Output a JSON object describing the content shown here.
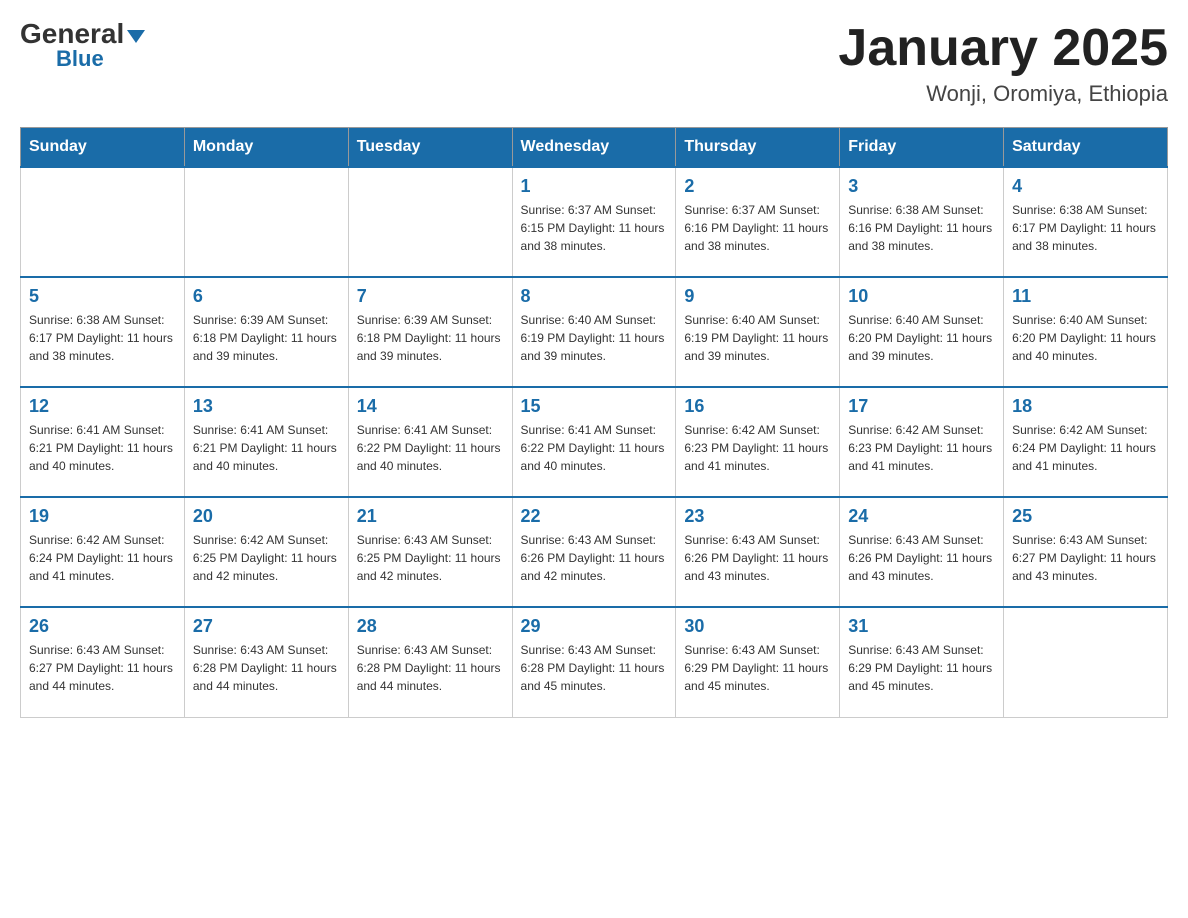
{
  "header": {
    "logo_general": "General",
    "logo_blue": "Blue",
    "month_title": "January 2025",
    "location": "Wonji, Oromiya, Ethiopia"
  },
  "days_of_week": [
    "Sunday",
    "Monday",
    "Tuesday",
    "Wednesday",
    "Thursday",
    "Friday",
    "Saturday"
  ],
  "weeks": [
    [
      {
        "day": "",
        "info": ""
      },
      {
        "day": "",
        "info": ""
      },
      {
        "day": "",
        "info": ""
      },
      {
        "day": "1",
        "info": "Sunrise: 6:37 AM\nSunset: 6:15 PM\nDaylight: 11 hours\nand 38 minutes."
      },
      {
        "day": "2",
        "info": "Sunrise: 6:37 AM\nSunset: 6:16 PM\nDaylight: 11 hours\nand 38 minutes."
      },
      {
        "day": "3",
        "info": "Sunrise: 6:38 AM\nSunset: 6:16 PM\nDaylight: 11 hours\nand 38 minutes."
      },
      {
        "day": "4",
        "info": "Sunrise: 6:38 AM\nSunset: 6:17 PM\nDaylight: 11 hours\nand 38 minutes."
      }
    ],
    [
      {
        "day": "5",
        "info": "Sunrise: 6:38 AM\nSunset: 6:17 PM\nDaylight: 11 hours\nand 38 minutes."
      },
      {
        "day": "6",
        "info": "Sunrise: 6:39 AM\nSunset: 6:18 PM\nDaylight: 11 hours\nand 39 minutes."
      },
      {
        "day": "7",
        "info": "Sunrise: 6:39 AM\nSunset: 6:18 PM\nDaylight: 11 hours\nand 39 minutes."
      },
      {
        "day": "8",
        "info": "Sunrise: 6:40 AM\nSunset: 6:19 PM\nDaylight: 11 hours\nand 39 minutes."
      },
      {
        "day": "9",
        "info": "Sunrise: 6:40 AM\nSunset: 6:19 PM\nDaylight: 11 hours\nand 39 minutes."
      },
      {
        "day": "10",
        "info": "Sunrise: 6:40 AM\nSunset: 6:20 PM\nDaylight: 11 hours\nand 39 minutes."
      },
      {
        "day": "11",
        "info": "Sunrise: 6:40 AM\nSunset: 6:20 PM\nDaylight: 11 hours\nand 40 minutes."
      }
    ],
    [
      {
        "day": "12",
        "info": "Sunrise: 6:41 AM\nSunset: 6:21 PM\nDaylight: 11 hours\nand 40 minutes."
      },
      {
        "day": "13",
        "info": "Sunrise: 6:41 AM\nSunset: 6:21 PM\nDaylight: 11 hours\nand 40 minutes."
      },
      {
        "day": "14",
        "info": "Sunrise: 6:41 AM\nSunset: 6:22 PM\nDaylight: 11 hours\nand 40 minutes."
      },
      {
        "day": "15",
        "info": "Sunrise: 6:41 AM\nSunset: 6:22 PM\nDaylight: 11 hours\nand 40 minutes."
      },
      {
        "day": "16",
        "info": "Sunrise: 6:42 AM\nSunset: 6:23 PM\nDaylight: 11 hours\nand 41 minutes."
      },
      {
        "day": "17",
        "info": "Sunrise: 6:42 AM\nSunset: 6:23 PM\nDaylight: 11 hours\nand 41 minutes."
      },
      {
        "day": "18",
        "info": "Sunrise: 6:42 AM\nSunset: 6:24 PM\nDaylight: 11 hours\nand 41 minutes."
      }
    ],
    [
      {
        "day": "19",
        "info": "Sunrise: 6:42 AM\nSunset: 6:24 PM\nDaylight: 11 hours\nand 41 minutes."
      },
      {
        "day": "20",
        "info": "Sunrise: 6:42 AM\nSunset: 6:25 PM\nDaylight: 11 hours\nand 42 minutes."
      },
      {
        "day": "21",
        "info": "Sunrise: 6:43 AM\nSunset: 6:25 PM\nDaylight: 11 hours\nand 42 minutes."
      },
      {
        "day": "22",
        "info": "Sunrise: 6:43 AM\nSunset: 6:26 PM\nDaylight: 11 hours\nand 42 minutes."
      },
      {
        "day": "23",
        "info": "Sunrise: 6:43 AM\nSunset: 6:26 PM\nDaylight: 11 hours\nand 43 minutes."
      },
      {
        "day": "24",
        "info": "Sunrise: 6:43 AM\nSunset: 6:26 PM\nDaylight: 11 hours\nand 43 minutes."
      },
      {
        "day": "25",
        "info": "Sunrise: 6:43 AM\nSunset: 6:27 PM\nDaylight: 11 hours\nand 43 minutes."
      }
    ],
    [
      {
        "day": "26",
        "info": "Sunrise: 6:43 AM\nSunset: 6:27 PM\nDaylight: 11 hours\nand 44 minutes."
      },
      {
        "day": "27",
        "info": "Sunrise: 6:43 AM\nSunset: 6:28 PM\nDaylight: 11 hours\nand 44 minutes."
      },
      {
        "day": "28",
        "info": "Sunrise: 6:43 AM\nSunset: 6:28 PM\nDaylight: 11 hours\nand 44 minutes."
      },
      {
        "day": "29",
        "info": "Sunrise: 6:43 AM\nSunset: 6:28 PM\nDaylight: 11 hours\nand 45 minutes."
      },
      {
        "day": "30",
        "info": "Sunrise: 6:43 AM\nSunset: 6:29 PM\nDaylight: 11 hours\nand 45 minutes."
      },
      {
        "day": "31",
        "info": "Sunrise: 6:43 AM\nSunset: 6:29 PM\nDaylight: 11 hours\nand 45 minutes."
      },
      {
        "day": "",
        "info": ""
      }
    ]
  ]
}
